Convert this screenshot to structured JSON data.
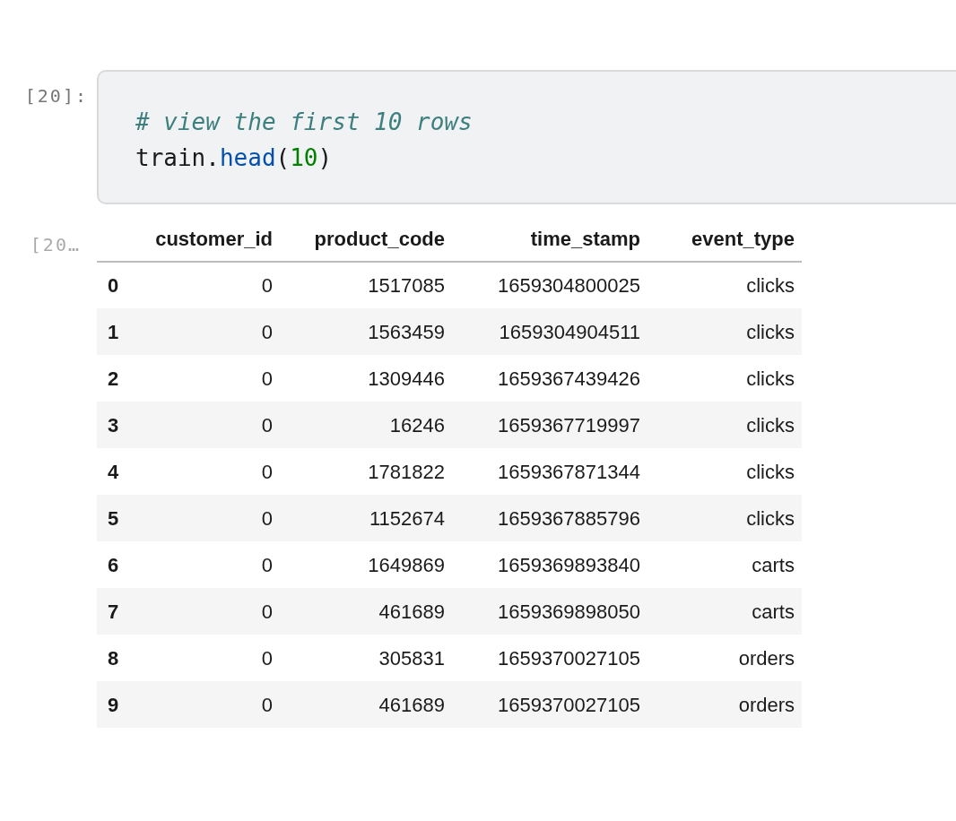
{
  "input_cell": {
    "prompt": "[20]:",
    "lines": [
      [
        {
          "kind": "comment",
          "text": "# view the first 10 rows"
        }
      ],
      [
        {
          "kind": "name",
          "text": "train."
        },
        {
          "kind": "method",
          "text": "head"
        },
        {
          "kind": "name",
          "text": "("
        },
        {
          "kind": "number",
          "text": "10"
        },
        {
          "kind": "name",
          "text": ")"
        }
      ]
    ]
  },
  "output_cell": {
    "prompt": "[20…",
    "table": {
      "columns": [
        "",
        "customer_id",
        "product_code",
        "time_stamp",
        "event_type"
      ],
      "rows": [
        [
          "0",
          "0",
          "1517085",
          "1659304800025",
          "clicks"
        ],
        [
          "1",
          "0",
          "1563459",
          "1659304904511",
          "clicks"
        ],
        [
          "2",
          "0",
          "1309446",
          "1659367439426",
          "clicks"
        ],
        [
          "3",
          "0",
          "16246",
          "1659367719997",
          "clicks"
        ],
        [
          "4",
          "0",
          "1781822",
          "1659367871344",
          "clicks"
        ],
        [
          "5",
          "0",
          "1152674",
          "1659367885796",
          "clicks"
        ],
        [
          "6",
          "0",
          "1649869",
          "1659369893840",
          "carts"
        ],
        [
          "7",
          "0",
          "461689",
          "1659369898050",
          "carts"
        ],
        [
          "8",
          "0",
          "305831",
          "1659370027105",
          "orders"
        ],
        [
          "9",
          "0",
          "461689",
          "1659370027105",
          "orders"
        ]
      ]
    }
  }
}
